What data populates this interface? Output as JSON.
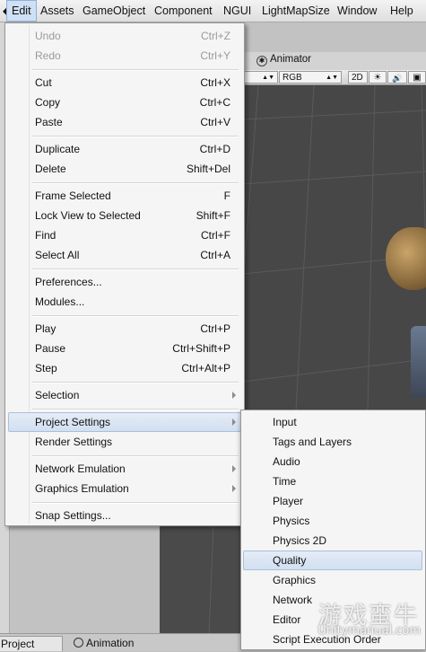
{
  "menubar": {
    "logo": "◆",
    "items": [
      "Edit",
      "Assets",
      "GameObject",
      "Component",
      "NGUI",
      "LightMapSize",
      "Window",
      "Help"
    ]
  },
  "scene": {
    "animator_tab": "Animator",
    "rgb_label": "RGB",
    "mode_2d": "2D",
    "sun_icon": "☀",
    "audio_icon": "🔊",
    "fx_icon": "▣"
  },
  "edit_menu": {
    "items": [
      {
        "label": "Undo",
        "shortcut": "Ctrl+Z",
        "disabled": true
      },
      {
        "label": "Redo",
        "shortcut": "Ctrl+Y",
        "disabled": true
      },
      {
        "label": "Cut",
        "shortcut": "Ctrl+X"
      },
      {
        "label": "Copy",
        "shortcut": "Ctrl+C"
      },
      {
        "label": "Paste",
        "shortcut": "Ctrl+V"
      },
      {
        "label": "Duplicate",
        "shortcut": "Ctrl+D"
      },
      {
        "label": "Delete",
        "shortcut": "Shift+Del"
      },
      {
        "label": "Frame Selected",
        "shortcut": "F"
      },
      {
        "label": "Lock View to Selected",
        "shortcut": "Shift+F"
      },
      {
        "label": "Find",
        "shortcut": "Ctrl+F"
      },
      {
        "label": "Select All",
        "shortcut": "Ctrl+A"
      },
      {
        "label": "Preferences...",
        "shortcut": ""
      },
      {
        "label": "Modules...",
        "shortcut": ""
      },
      {
        "label": "Play",
        "shortcut": "Ctrl+P"
      },
      {
        "label": "Pause",
        "shortcut": "Ctrl+Shift+P"
      },
      {
        "label": "Step",
        "shortcut": "Ctrl+Alt+P"
      },
      {
        "label": "Selection",
        "submenu": true
      },
      {
        "label": "Project Settings",
        "submenu": true,
        "highlighted": true
      },
      {
        "label": "Render Settings"
      },
      {
        "label": "Network Emulation",
        "submenu": true
      },
      {
        "label": "Graphics Emulation",
        "submenu": true
      },
      {
        "label": "Snap Settings..."
      }
    ]
  },
  "project_settings_menu": {
    "items": [
      "Input",
      "Tags and Layers",
      "Audio",
      "Time",
      "Player",
      "Physics",
      "Physics 2D",
      "Quality",
      "Graphics",
      "Network",
      "Editor",
      "Script Execution Order"
    ],
    "highlighted": "Quality"
  },
  "bottom_tabs": [
    {
      "label": "Project",
      "selected": true
    },
    {
      "label": "Animation",
      "selected": false
    }
  ],
  "watermark": {
    "chinese": "游戏蛮牛",
    "site": "Unitymanual.com"
  }
}
